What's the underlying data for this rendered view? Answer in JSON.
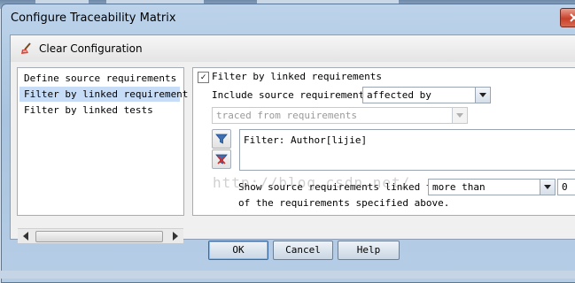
{
  "window": {
    "title": "Configure Traceability Matrix"
  },
  "toolbar": {
    "clear_label": "Clear Configuration"
  },
  "left_list": {
    "items": [
      {
        "label": "Define source requirements",
        "selected": false
      },
      {
        "label": "Filter by linked requirement",
        "selected": true
      },
      {
        "label": "Filter by linked tests",
        "selected": false
      }
    ]
  },
  "right": {
    "filter_checkbox_label": "Filter by linked requirements",
    "filter_checked": true,
    "include_label": "Include source requirements",
    "include_value": "affected by",
    "traced_value": "traced from requirements",
    "filter_text": "Filter: Author[lijie]",
    "watermark": "http://blog.csdn.net/",
    "show_label": "Show source requirements linked to",
    "show_value": "more than",
    "count_value": "0",
    "of_label": "of the requirements specified above."
  },
  "buttons": {
    "ok": "OK",
    "cancel": "Cancel",
    "help": "Help"
  },
  "icons": [
    "broom-icon",
    "filter-icon",
    "clear-filter-icon",
    "close-icon",
    "chevron-down-icon"
  ],
  "colors": {
    "selection": "#c6dcf7",
    "titlebar": "#a9c4df",
    "close": "#c8402a"
  }
}
